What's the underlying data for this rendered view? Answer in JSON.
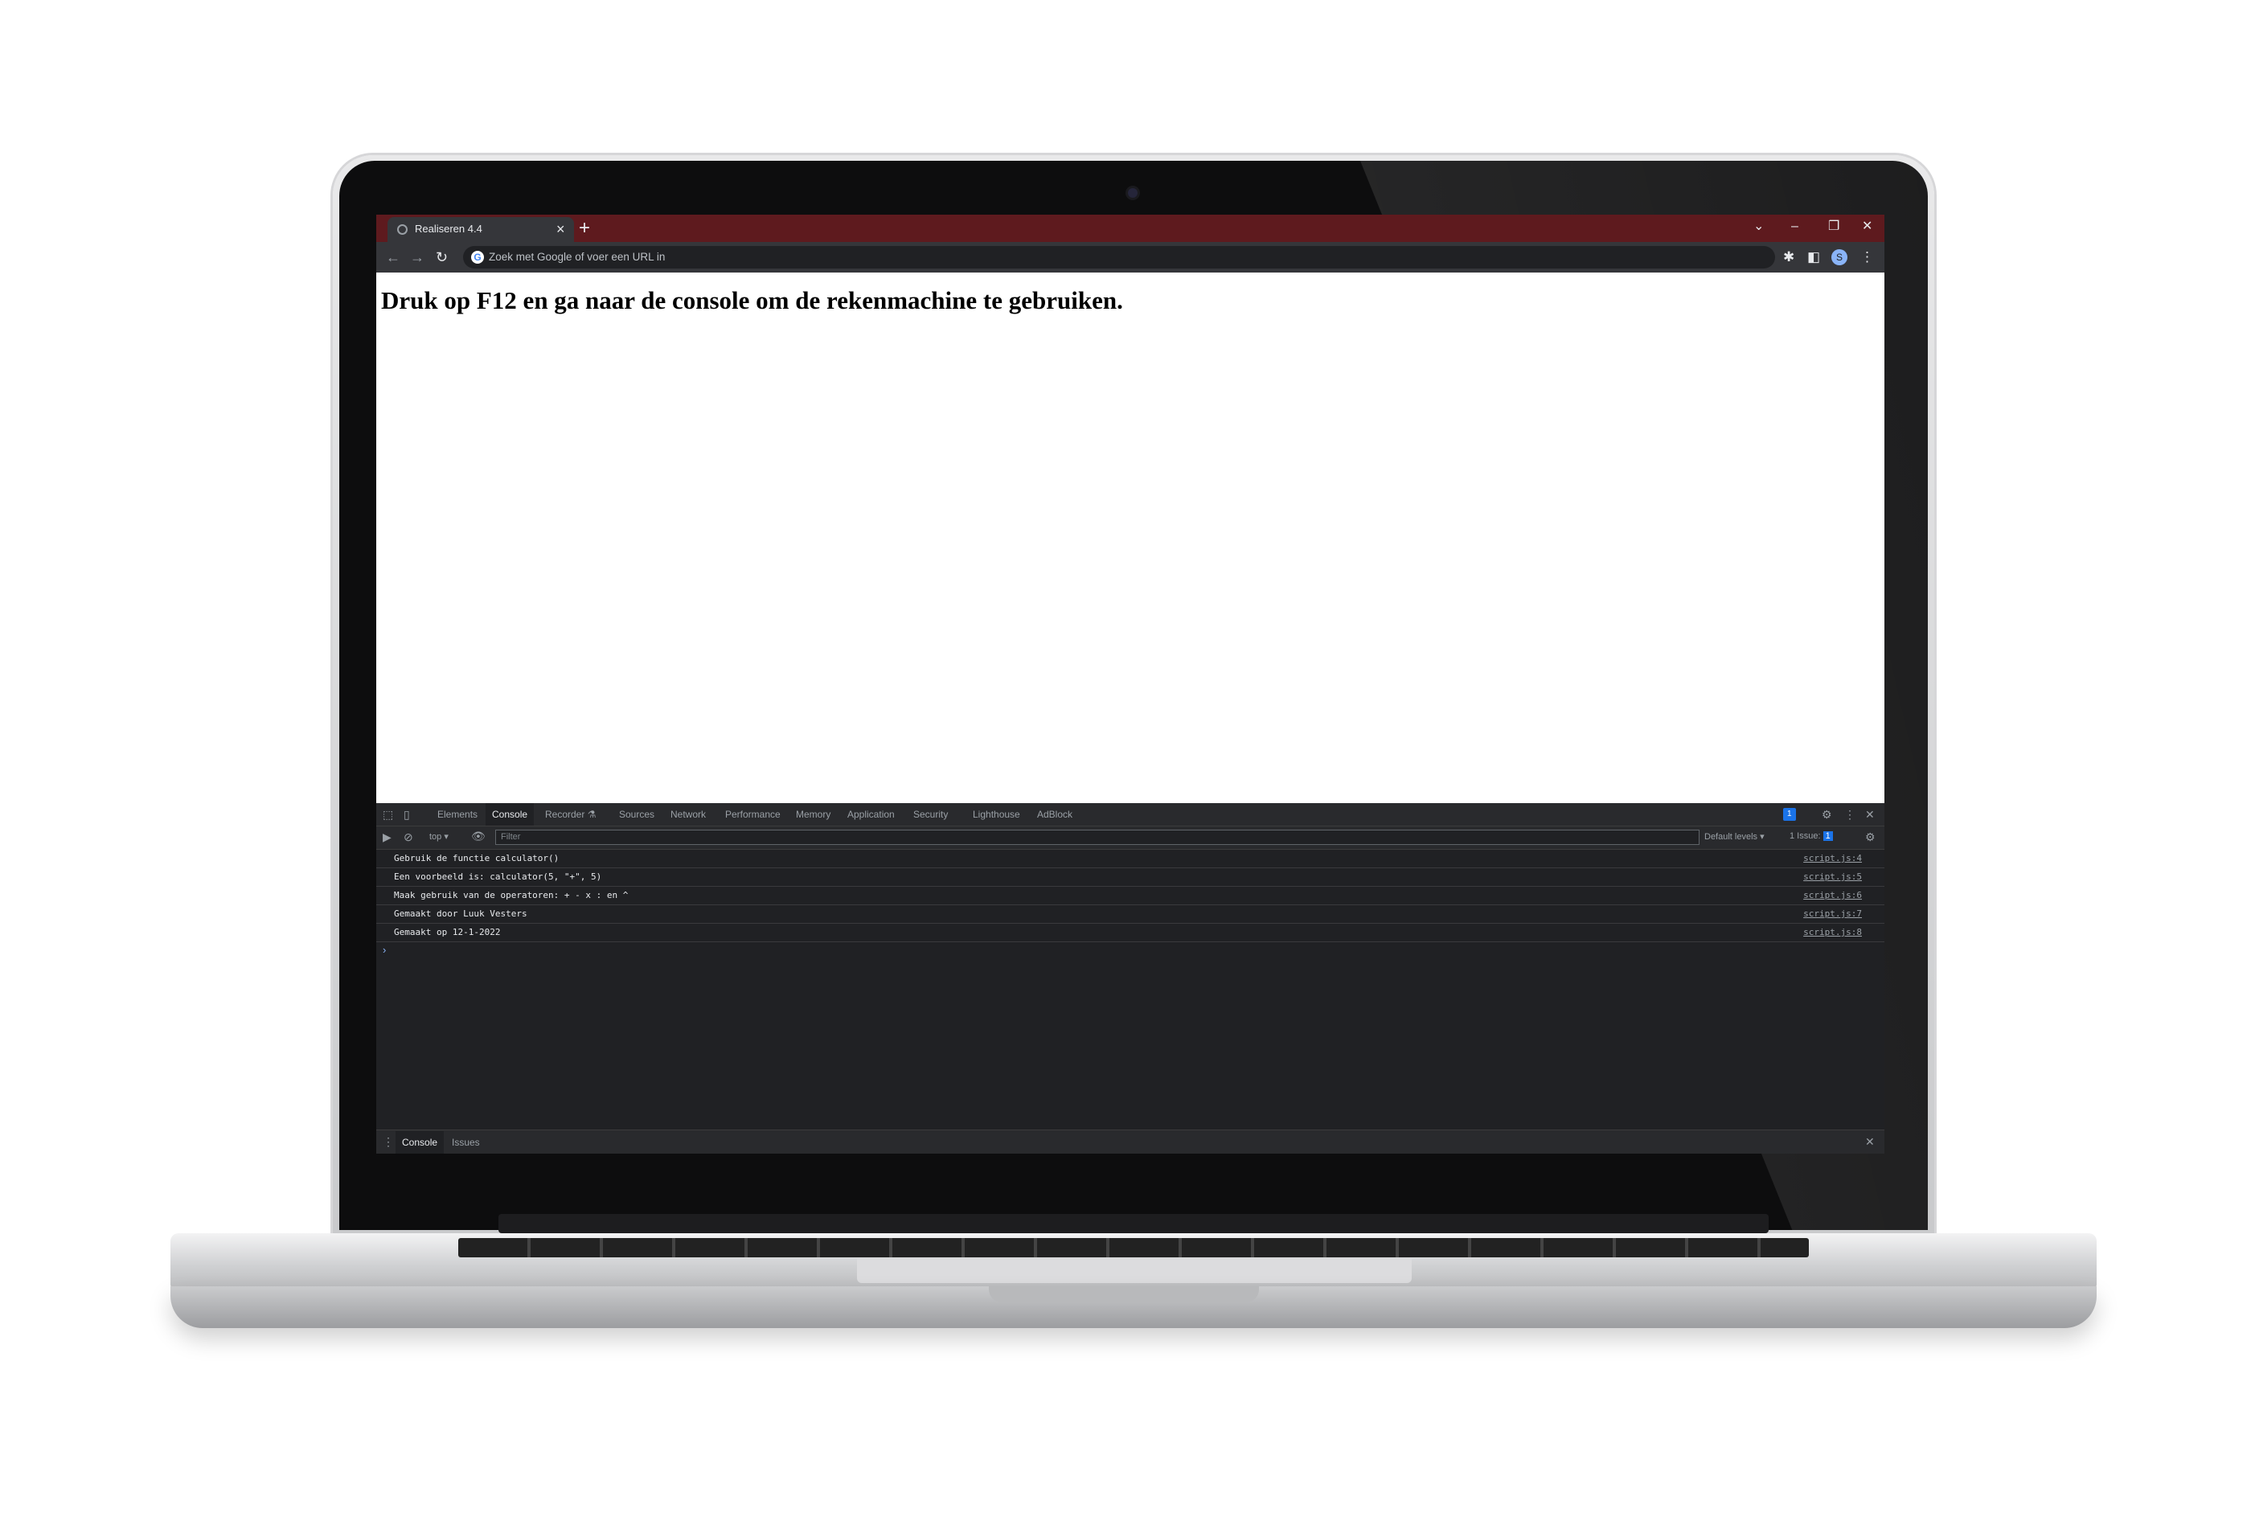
{
  "browser": {
    "tab_title": "Realiseren 4.4",
    "tab_close_glyph": "×",
    "new_tab_glyph": "+",
    "omnibox_placeholder": "Zoek met Google of voer een URL in",
    "profile_initial": "S",
    "window_controls": {
      "tab_search": "⌄",
      "minimize": "–",
      "restore": "❐",
      "close": "✕"
    },
    "nav_icons": {
      "back": "←",
      "forward": "→",
      "reload": "↻"
    }
  },
  "page": {
    "heading": "Druk op F12 en ga naar de console om de rekenmachine te gebruiken."
  },
  "devtools": {
    "tabs": [
      "Elements",
      "Console",
      "Recorder",
      "Sources",
      "Network",
      "Performance",
      "Memory",
      "Application",
      "Security",
      "Lighthouse",
      "AdBlock"
    ],
    "active_tab": "Console",
    "recorder_flask_glyph": "⚗",
    "issues_badge": "1",
    "context": "top ▾",
    "filter_placeholder": "Filter",
    "levels": "Default levels ▾",
    "issues_text": "1 Issue:",
    "issues_count": "1",
    "console_messages": [
      {
        "text": "Gebruik de functie calculator()",
        "source": "script.js:4"
      },
      {
        "text": "Een voorbeeld is: calculator(5, \"+\", 5)",
        "source": "script.js:5"
      },
      {
        "text": "Maak gebruik van de operatoren: + - x : en ^",
        "source": "script.js:6"
      },
      {
        "text": "Gemaakt door Luuk Vesters",
        "source": "script.js:7"
      },
      {
        "text": "Gemaakt op 12-1-2022",
        "source": "script.js:8"
      }
    ],
    "prompt_glyph": "›",
    "drawer_tabs": [
      "Console",
      "Issues"
    ],
    "drawer_close": "✕"
  },
  "colors": {
    "tab_strip": "#5e1a1e",
    "toolbar": "#35363a",
    "devtools_bg": "#202124"
  }
}
